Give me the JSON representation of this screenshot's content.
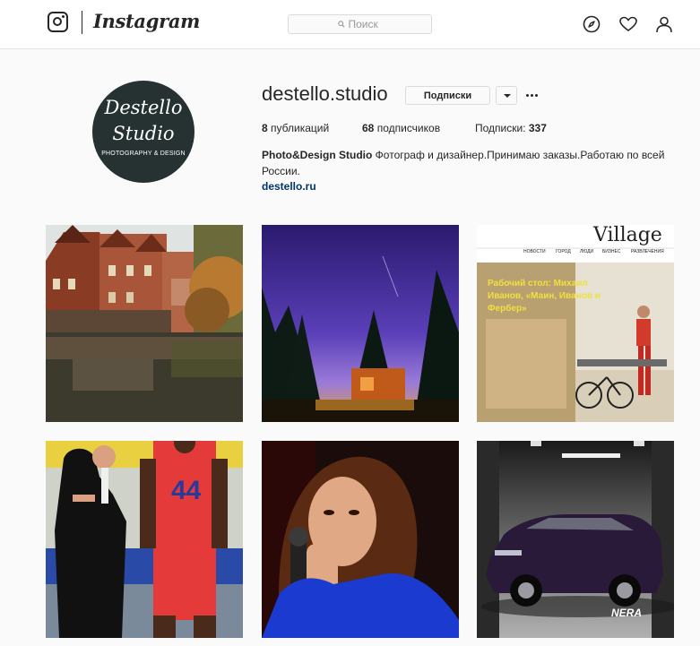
{
  "topbar": {
    "wordmark": "Instagram",
    "search_placeholder": "Поиск"
  },
  "profile": {
    "avatar": {
      "line1": "Destello",
      "line2": "Studio",
      "line3": "PHOTOGRAPHY & DESIGN"
    },
    "username": "destello.studio",
    "follow_label": "Подписки",
    "posts_count": "8",
    "posts_label": "публикаций",
    "followers_count": "68",
    "followers_label": "подписчиков",
    "following_label": "Подписки:",
    "following_count": "337",
    "full_name": "Photo&Design Studio",
    "bio_text": "Фотограф и дизайнер.Принимаю заказы.Работаю по всей России.",
    "website": "destello.ru"
  },
  "posts": [
    {
      "subject": "canal-houses-photo"
    },
    {
      "subject": "night-sky-trees-photo"
    },
    {
      "subject": "village-magazine-page",
      "masthead": "Village",
      "nav": [
        "НОВОСТИ",
        "ГОРОД",
        "ЛЮДИ",
        "БИЗНЕС",
        "РАЗВЛЕЧЕНИЯ"
      ],
      "headline": "Рабочий стол: Михаил Иванов, «Маин, Иванов и Фербер»"
    },
    {
      "subject": "basketball-photo",
      "jersey_number": "44"
    },
    {
      "subject": "singer-microphone-photo"
    },
    {
      "subject": "car-studio-photo",
      "watermark": "NERA"
    }
  ],
  "colors": {
    "link": "#003569",
    "avatar_bg": "#263131",
    "border": "#dbdbdb"
  }
}
